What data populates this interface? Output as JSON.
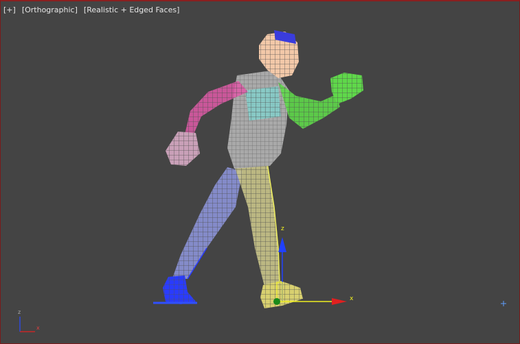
{
  "viewport": {
    "menu_label": "[+]",
    "view_label": "[Orthographic]",
    "shading_label": "[Realistic + Edged Faces]",
    "border_color": "#8a1f1f",
    "background_color": "#444444"
  },
  "gizmo": {
    "x_label": "x",
    "z_label": "z",
    "x_color": "#e02020",
    "z_color": "#2040ff",
    "plane_color": "#f0f020"
  },
  "axis_tripod": {
    "x_label": "x",
    "z_label": "z"
  },
  "model": {
    "skin_color": "#f2c8a8",
    "mesh_color": "#a9a9a9",
    "left_arm_color": "#e05aa8",
    "right_arm_color": "#5fd84a",
    "torso_color": "#7fd6d0",
    "left_leg_color": "#8c94d8",
    "right_leg_color": "#c9c48a",
    "left_foot_color": "#2a3cff",
    "head_top_color": "#3a3cdd"
  },
  "icons": {
    "pivot": "pivot-plus-icon"
  }
}
